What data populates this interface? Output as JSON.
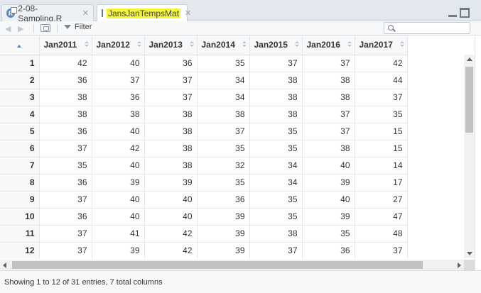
{
  "tabs": [
    {
      "label": "2-08-Sampling.R",
      "close": "✕"
    },
    {
      "label": "JansJanTempsMat",
      "close": "✕"
    }
  ],
  "toolbar": {
    "filter_label": "Filter",
    "search_placeholder": ""
  },
  "table": {
    "columns": [
      "Jan2011",
      "Jan2012",
      "Jan2013",
      "Jan2014",
      "Jan2015",
      "Jan2016",
      "Jan2017"
    ],
    "rows": [
      {
        "n": "1",
        "values": [
          "42",
          "40",
          "36",
          "35",
          "37",
          "37",
          "42"
        ]
      },
      {
        "n": "2",
        "values": [
          "36",
          "37",
          "37",
          "34",
          "38",
          "38",
          "44"
        ]
      },
      {
        "n": "3",
        "values": [
          "38",
          "36",
          "37",
          "34",
          "38",
          "38",
          "37"
        ]
      },
      {
        "n": "4",
        "values": [
          "38",
          "38",
          "38",
          "38",
          "38",
          "37",
          "35"
        ]
      },
      {
        "n": "5",
        "values": [
          "36",
          "40",
          "38",
          "37",
          "35",
          "37",
          "15"
        ]
      },
      {
        "n": "6",
        "values": [
          "37",
          "42",
          "38",
          "35",
          "35",
          "38",
          "15"
        ]
      },
      {
        "n": "7",
        "values": [
          "35",
          "40",
          "38",
          "32",
          "34",
          "40",
          "14"
        ]
      },
      {
        "n": "8",
        "values": [
          "36",
          "39",
          "39",
          "35",
          "34",
          "39",
          "17"
        ]
      },
      {
        "n": "9",
        "values": [
          "37",
          "40",
          "40",
          "36",
          "35",
          "40",
          "27"
        ]
      },
      {
        "n": "10",
        "values": [
          "36",
          "40",
          "40",
          "39",
          "35",
          "39",
          "47"
        ]
      },
      {
        "n": "11",
        "values": [
          "37",
          "41",
          "42",
          "39",
          "38",
          "35",
          "48"
        ]
      },
      {
        "n": "12",
        "values": [
          "37",
          "39",
          "42",
          "39",
          "37",
          "36",
          "37"
        ]
      }
    ]
  },
  "status": {
    "text": "Showing 1 to 12 of 31 entries, 7 total columns"
  },
  "colors": {
    "highlight": "#f2f53a",
    "sort_accent": "#4f7fb6"
  }
}
